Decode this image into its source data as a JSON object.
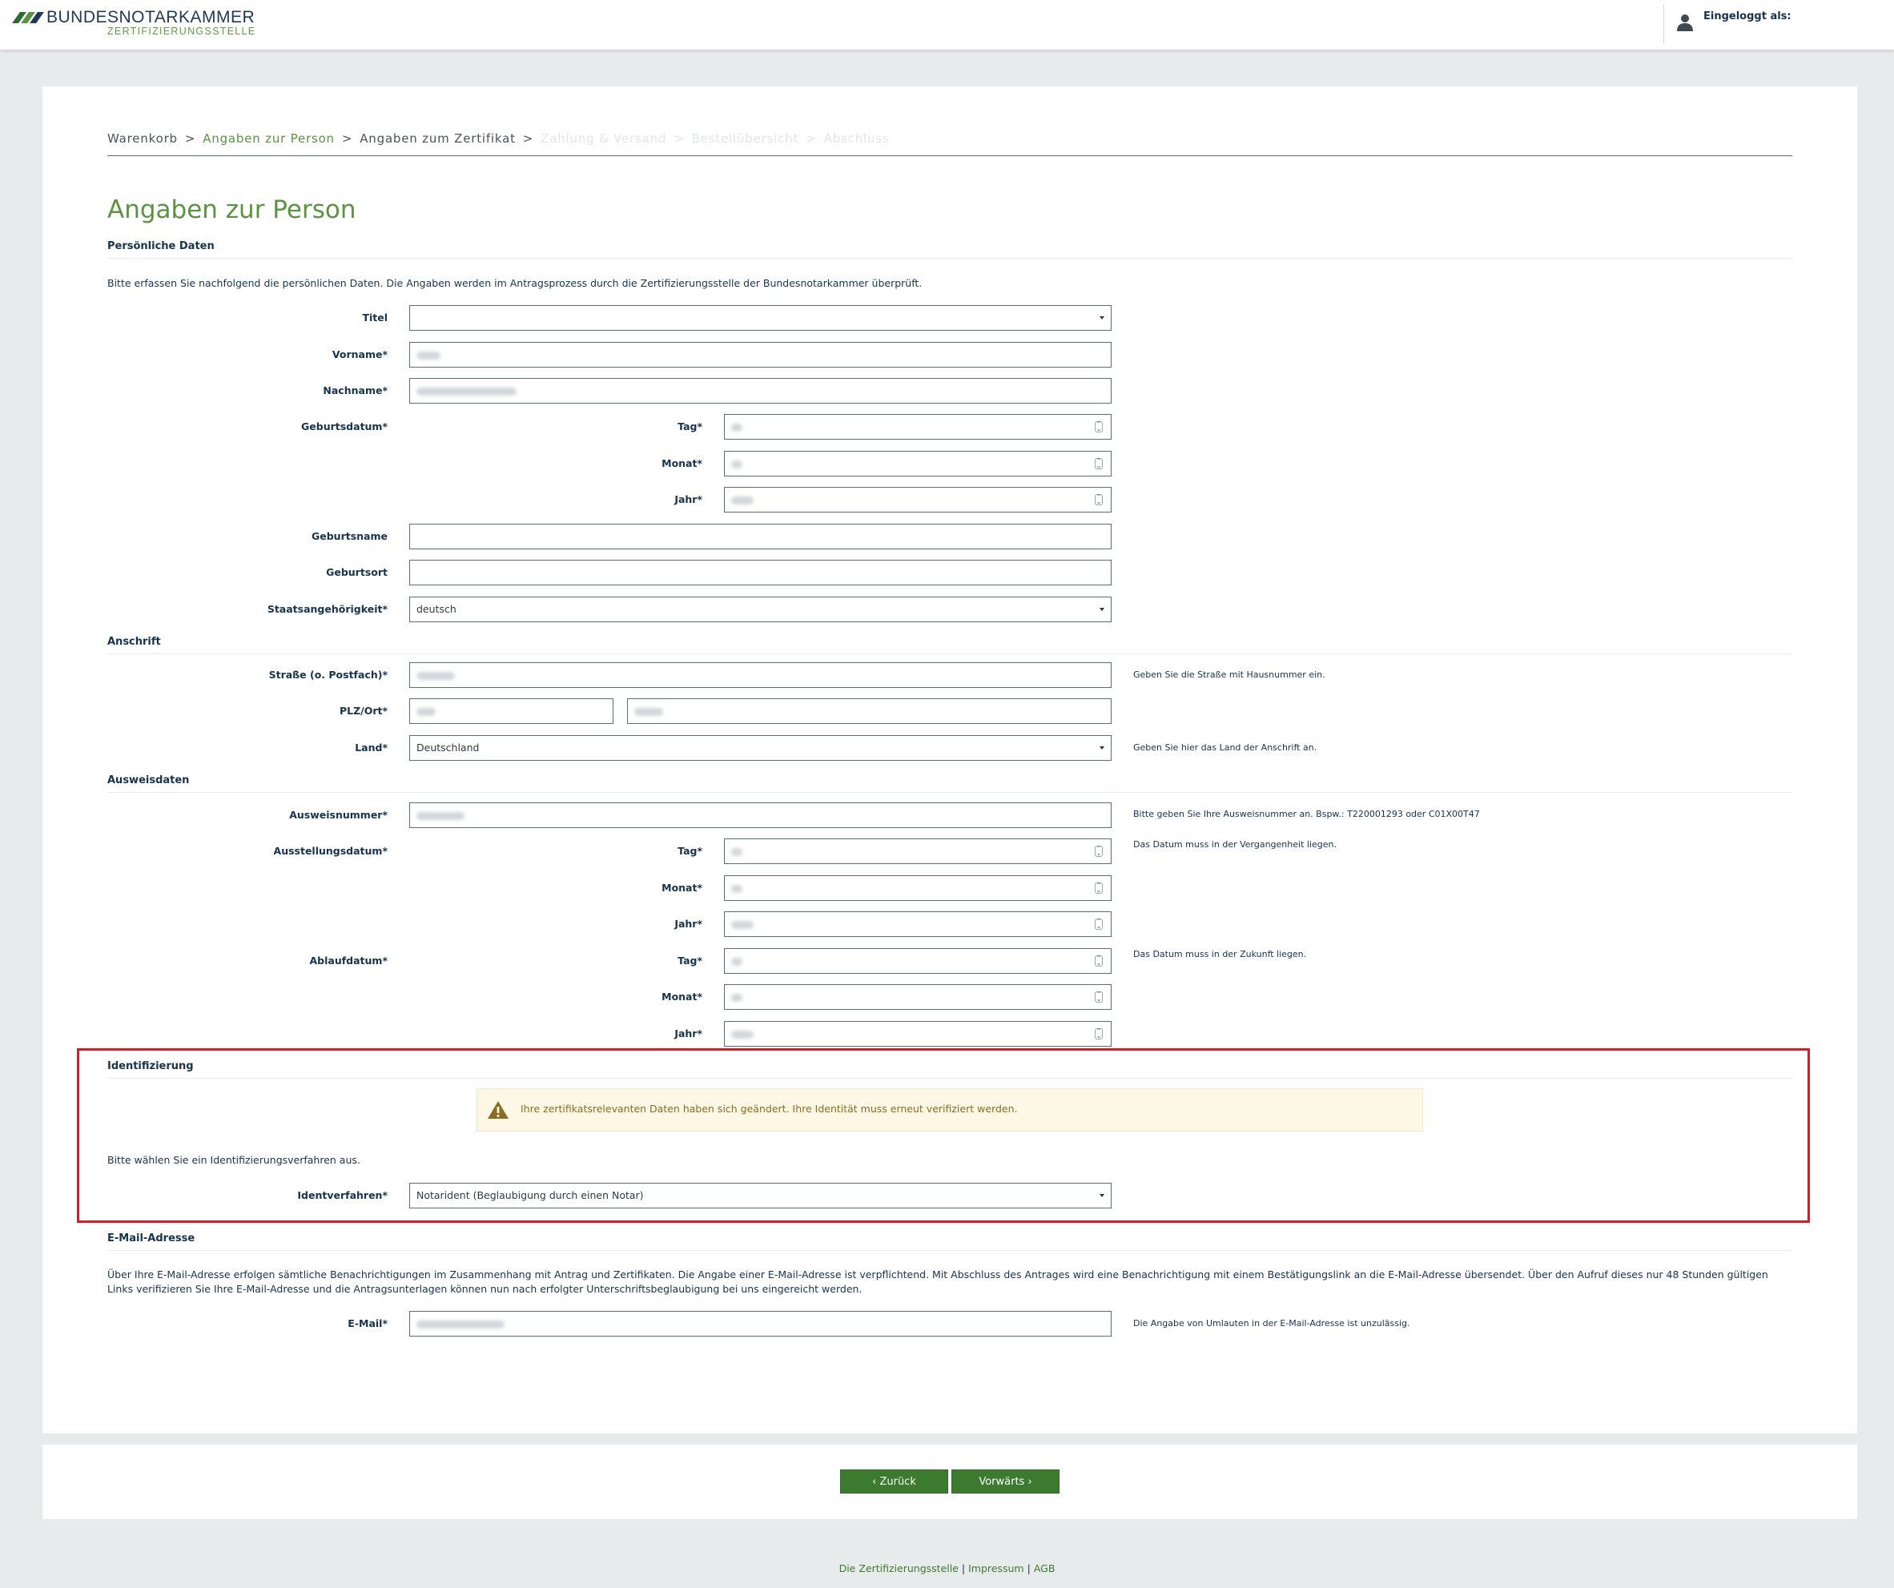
{
  "header": {
    "brand_name": "BUNDESNOTARKAMMER",
    "brand_sub": "ZERTIFIZIERUNGSSTELLE",
    "logged_in_label": "Eingeloggt als:"
  },
  "breadcrumb": [
    "Warenkorb",
    "Angaben zur Person",
    "Angaben zum Zertifikat",
    "Zahlung & Versand",
    "Bestellübersicht",
    "Abschluss"
  ],
  "page_title": "Angaben zur Person",
  "personal": {
    "heading": "Persönliche Daten",
    "intro": "Bitte erfassen Sie nachfolgend die persönlichen Daten. Die Angaben werden im Antragsprozess durch die Zertifizierungsstelle der Bundesnotarkammer überprüft.",
    "titel_label": "Titel",
    "titel_value": "",
    "vorname_label": "Vorname*",
    "nachname_label": "Nachname*",
    "geburtsdatum_label": "Geburtsdatum*",
    "tag_label": "Tag*",
    "monat_label": "Monat*",
    "jahr_label": "Jahr*",
    "geburtsname_label": "Geburtsname",
    "geburtsort_label": "Geburtsort",
    "staat_label": "Staatsangehörigkeit*",
    "staat_value": "deutsch"
  },
  "address": {
    "heading": "Anschrift",
    "strasse_label": "Straße (o. Postfach)*",
    "strasse_hint": "Geben Sie die Straße mit Hausnummer ein.",
    "plz_label": "PLZ/Ort*",
    "land_label": "Land*",
    "land_value": "Deutschland",
    "land_hint": "Geben Sie hier das Land der Anschrift an."
  },
  "id_doc": {
    "heading": "Ausweisdaten",
    "nummer_label": "Ausweisnummer*",
    "nummer_hint": "Bitte geben Sie Ihre Ausweisnummer an. Bspw.: T220001293 oder C01X00T47",
    "ausstellung_label": "Ausstellungsdatum*",
    "ausstellung_hint": "Das Datum muss in der Vergangenheit liegen.",
    "ablauf_label": "Ablaufdatum*",
    "ablauf_hint": "Das Datum muss in der Zukunft liegen."
  },
  "ident": {
    "heading": "Identifizierung",
    "alert": "Ihre zertifikatsrelevanten Daten haben sich geändert. Ihre Identität muss erneut verifiziert werden.",
    "instruction": "Bitte wählen Sie ein Identifizierungsverfahren aus.",
    "verfahren_label": "Identverfahren*",
    "verfahren_value": "Notarident (Beglaubigung durch einen Notar)"
  },
  "email": {
    "heading": "E-Mail-Adresse",
    "intro": "Über Ihre E-Mail-Adresse erfolgen sämtliche Benachrichtigungen im Zusammenhang mit Antrag und Zertifikaten. Die Angabe einer E-Mail-Adresse ist verpflichtend. Mit Abschluss des Antrages wird eine Benachrichtigung mit einem Bestätigungslink an die E-Mail-Adresse übersendet. Über den Aufruf dieses nur 48 Stunden gültigen Links verifizieren Sie Ihre E-Mail-Adresse und die Antragsunterlagen können nun nach erfolgter Unterschriftsbeglaubigung bei uns eingereicht werden.",
    "label": "E-Mail*",
    "hint": "Die Angabe von Umlauten in der E-Mail-Adresse ist unzulässig."
  },
  "nav": {
    "back": "‹ Zurück",
    "forward": "Vorwärts ›"
  },
  "footer": [
    "Die Zertifizierungsstelle",
    "Impressum",
    "AGB"
  ],
  "colors": {
    "brand_green": "#5b9441",
    "button_green": "#3b7a2f",
    "navy": "#17334e",
    "highlight_red": "#d21e24",
    "alert_bg": "#fdf7e6"
  },
  "icons": [
    "user-icon",
    "warning-icon",
    "chevron-down-icon",
    "spinner-icon",
    "chevron-left-icon",
    "chevron-right-icon"
  ]
}
